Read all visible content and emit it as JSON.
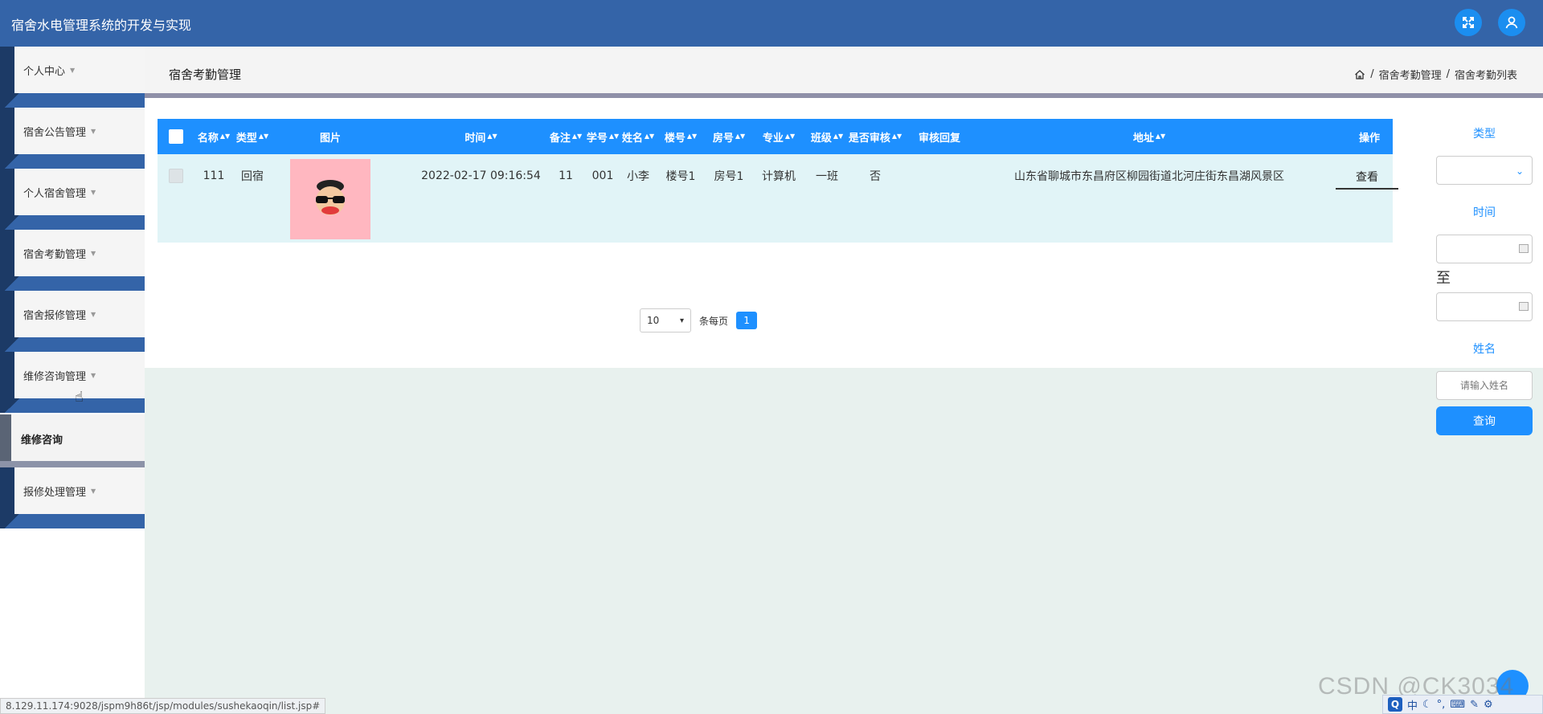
{
  "app": {
    "title": "宿舍水电管理系统的开发与实现"
  },
  "sidebar": {
    "items": [
      {
        "label": "个人中心"
      },
      {
        "label": "宿舍公告管理"
      },
      {
        "label": "个人宿舍管理"
      },
      {
        "label": "宿舍考勤管理"
      },
      {
        "label": "宿舍报修管理"
      },
      {
        "label": "维修咨询管理"
      },
      {
        "label": "报修处理管理"
      }
    ],
    "sub_item": {
      "label": "维修咨询"
    }
  },
  "page": {
    "title": "宿舍考勤管理",
    "breadcrumb": [
      "宿舍考勤管理",
      "宿舍考勤列表"
    ]
  },
  "table": {
    "headers": {
      "name": "名称",
      "type": "类型",
      "image": "图片",
      "time": "时间",
      "remark": "备注",
      "student_no": "学号",
      "student_name": "姓名",
      "building": "楼号",
      "room": "房号",
      "major": "专业",
      "class": "班级",
      "reviewed": "是否审核",
      "review_reply": "审核回复",
      "address": "地址",
      "action": "操作"
    },
    "rows": [
      {
        "name": "111",
        "type": "回宿",
        "time": "2022-02-17 09:16:54",
        "remark": "11",
        "student_no": "001",
        "student_name": "小李",
        "building": "楼号1",
        "room": "房号1",
        "major": "计算机",
        "class": "一班",
        "reviewed": "否",
        "review_reply": "",
        "address": "山东省聊城市东昌府区柳园街道北河庄街东昌湖风景区",
        "action": "查看"
      }
    ]
  },
  "pagination": {
    "page_size": "10",
    "per_page_label": "条每页",
    "current_page": "1"
  },
  "filters": {
    "type_label": "类型",
    "time_label": "时间",
    "to_label": "至",
    "name_label": "姓名",
    "name_placeholder": "请输入姓名",
    "search_button": "查询"
  },
  "status": {
    "url": "8.129.11.174:9028/jspm9h86t/jsp/modules/sushekaoqin/list.jsp#"
  },
  "watermark": "CSDN @CK3034",
  "ime": {
    "mode": "中"
  },
  "colors": {
    "header": "#3464a8",
    "accent": "#1e90ff",
    "row": "#e1f4f7",
    "main_bg": "#e8f1ee"
  }
}
